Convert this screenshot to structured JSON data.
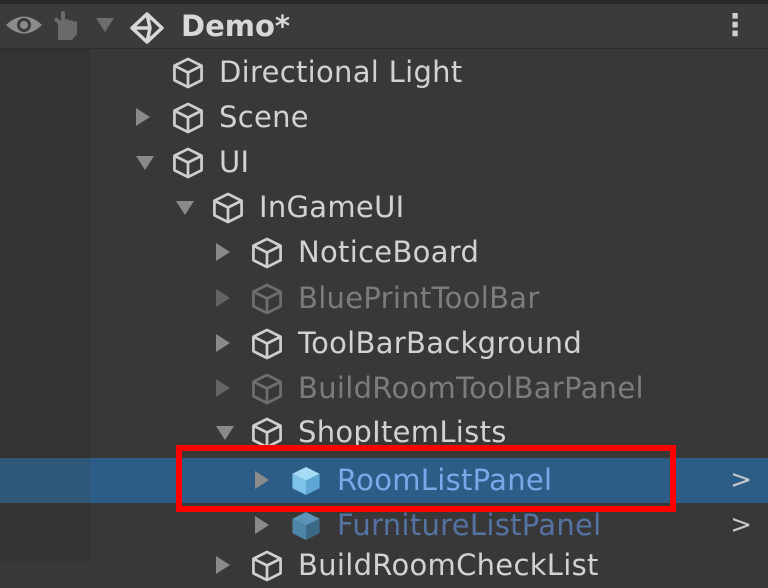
{
  "header": {
    "scene_name": "Demo*",
    "menu_glyph": "⋮"
  },
  "hierarchy": [
    {
      "label": "Directional Light",
      "arrow": "none",
      "state": "normal"
    },
    {
      "label": "Scene",
      "arrow": "right",
      "state": "normal"
    },
    {
      "label": "UI",
      "arrow": "down",
      "state": "normal"
    },
    {
      "label": "InGameUI",
      "arrow": "down",
      "state": "normal"
    },
    {
      "label": "NoticeBoard",
      "arrow": "right",
      "state": "normal"
    },
    {
      "label": "BluePrintToolBar",
      "arrow": "right",
      "state": "inactive"
    },
    {
      "label": "ToolBarBackground",
      "arrow": "right",
      "state": "normal"
    },
    {
      "label": "BuildRoomToolBarPanel",
      "arrow": "right",
      "state": "inactive"
    },
    {
      "label": "ShopItemLists",
      "arrow": "down",
      "state": "normal"
    },
    {
      "label": "RoomListPanel",
      "arrow": "right",
      "state": "prefab-selected",
      "chevron": ">"
    },
    {
      "label": "FurnitureListPanel",
      "arrow": "right",
      "state": "prefab-dim",
      "chevron": ">"
    },
    {
      "label": "BuildRoomCheckList",
      "arrow": "right",
      "state": "normal"
    }
  ],
  "colors": {
    "background": "#383838",
    "selection": "#2c5d87",
    "prefab_text": "#7aa9ea",
    "highlight": "#ff0000"
  },
  "icons": {
    "visibility": "eye-icon",
    "pickable": "hand-icon",
    "scene": "unity-logo-icon",
    "gameobject": "cube-icon",
    "prefab": "prefab-cube-icon"
  }
}
